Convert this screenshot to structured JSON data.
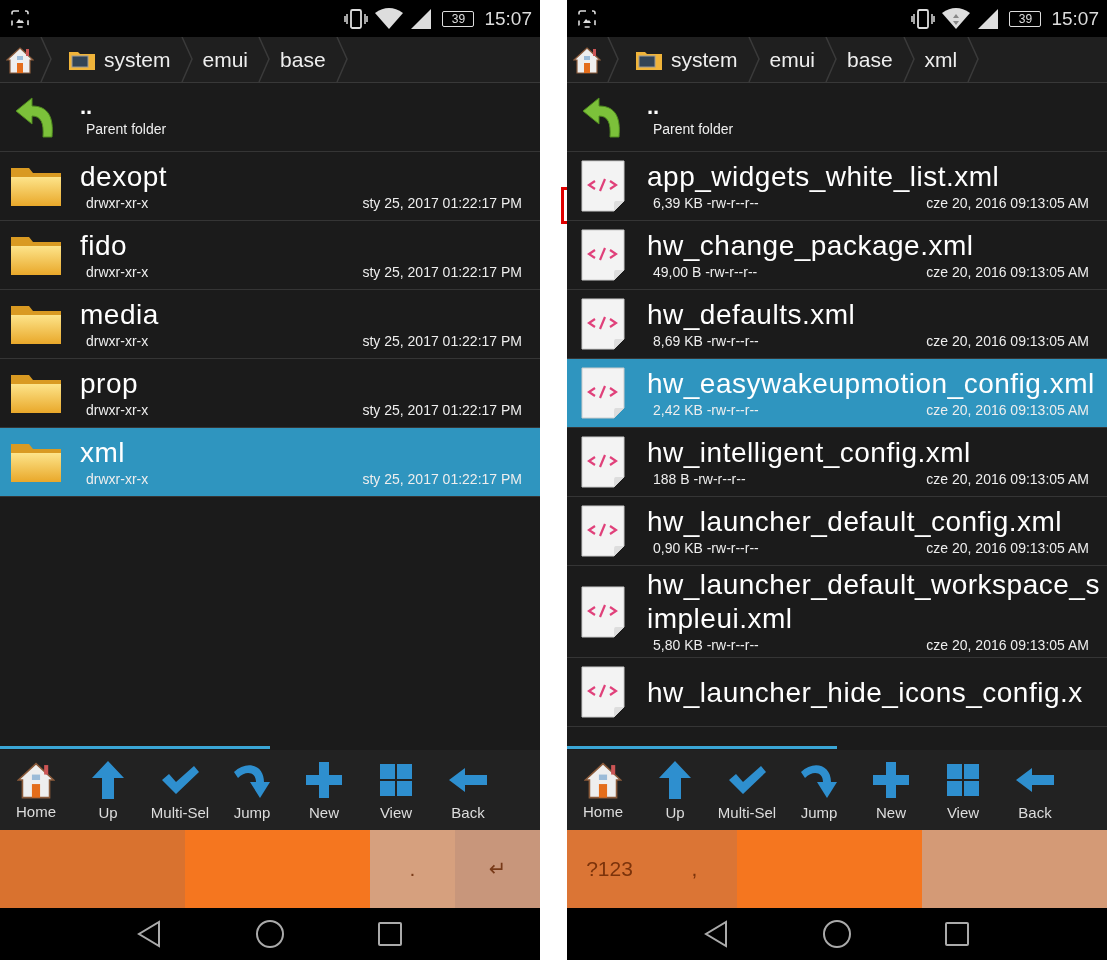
{
  "screens": [
    {
      "status_bar": {
        "wifi_arrows": false,
        "battery": "39",
        "time": "15:07"
      },
      "breadcrumbs": [
        "system",
        "emui",
        "base"
      ],
      "parent": {
        "name": "..",
        "label": "Parent folder"
      },
      "items": [
        {
          "kind": "folder",
          "name": "dexopt",
          "info": "drwxr-xr-x",
          "date": "sty 25, 2017 01:22:17 PM",
          "selected": false
        },
        {
          "kind": "folder",
          "name": "fido",
          "info": "drwxr-xr-x",
          "date": "sty 25, 2017 01:22:17 PM",
          "selected": false
        },
        {
          "kind": "folder",
          "name": "media",
          "info": "drwxr-xr-x",
          "date": "sty 25, 2017 01:22:17 PM",
          "selected": false
        },
        {
          "kind": "folder",
          "name": "prop",
          "info": "drwxr-xr-x",
          "date": "sty 25, 2017 01:22:17 PM",
          "selected": false
        },
        {
          "kind": "folder",
          "name": "xml",
          "info": "drwxr-xr-x",
          "date": "sty 25, 2017 01:22:17 PM",
          "selected": true
        }
      ],
      "toolbar": [
        {
          "kind": "home",
          "label": "Home"
        },
        {
          "kind": "up",
          "label": "Up"
        },
        {
          "kind": "multi",
          "label": "Multi-Sel"
        },
        {
          "kind": "jump",
          "label": "Jump"
        },
        {
          "kind": "new",
          "label": "New"
        },
        {
          "kind": "view",
          "label": "View"
        },
        {
          "kind": "back",
          "label": "Back"
        }
      ],
      "keyboard": [
        {
          "kind": "block",
          "color": "#d9722f"
        },
        {
          "kind": "block",
          "color": "#f5761f"
        },
        {
          "kind": "key",
          "color": "#d6a07e",
          "label": "."
        },
        {
          "kind": "key",
          "color": "#c8967b",
          "label": "↵"
        }
      ]
    },
    {
      "status_bar": {
        "wifi_arrows": true,
        "battery": "39",
        "time": "15:07"
      },
      "breadcrumbs": [
        "system",
        "emui",
        "base",
        "xml"
      ],
      "parent": {
        "name": "..",
        "label": "Parent folder"
      },
      "items": [
        {
          "kind": "xml",
          "name": "app_widgets_white_list.xml",
          "info": "6,39 KB -rw-r--r--",
          "date": "cze 20, 2016 09:13:05 AM",
          "selected": false
        },
        {
          "kind": "xml",
          "name": "hw_change_package.xml",
          "info": "49,00 B -rw-r--r--",
          "date": "cze 20, 2016 09:13:05 AM",
          "selected": false
        },
        {
          "kind": "xml",
          "name": "hw_defaults.xml",
          "info": "8,69 KB -rw-r--r--",
          "date": "cze 20, 2016 09:13:05 AM",
          "selected": false
        },
        {
          "kind": "xml",
          "name": "hw_easywakeupmotion_config.xml",
          "info": "2,42 KB -rw-r--r--",
          "date": "cze 20, 2016 09:13:05 AM",
          "selected": true
        },
        {
          "kind": "xml",
          "name": "hw_intelligent_config.xml",
          "info": "188 B -rw-r--r--",
          "date": "cze 20, 2016 09:13:05 AM",
          "selected": false
        },
        {
          "kind": "xml",
          "name": "hw_launcher_default_config.xml",
          "info": "0,90 KB -rw-r--r--",
          "date": "cze 20, 2016 09:13:05 AM",
          "selected": false
        },
        {
          "kind": "xml",
          "name": "hw_launcher_default_workspace_simpleui.xml",
          "info": "5,80 KB -rw-r--r--",
          "date": "cze 20, 2016 09:13:05 AM",
          "selected": false
        },
        {
          "kind": "xml",
          "name": "hw_launcher_hide_icons_config.x",
          "selected": false
        }
      ],
      "toolbar": [
        {
          "kind": "home",
          "label": "Home"
        },
        {
          "kind": "up",
          "label": "Up"
        },
        {
          "kind": "multi",
          "label": "Multi-Sel"
        },
        {
          "kind": "jump",
          "label": "Jump"
        },
        {
          "kind": "new",
          "label": "New"
        },
        {
          "kind": "view",
          "label": "View"
        },
        {
          "kind": "back",
          "label": "Back"
        }
      ],
      "keyboard": [
        {
          "kind": "key",
          "color": "#db7535",
          "label": "?123"
        },
        {
          "kind": "key",
          "color": "#db7535",
          "label": ","
        },
        {
          "kind": "block",
          "color": "#f5761f"
        },
        {
          "kind": "block",
          "color": "#d49a76"
        }
      ]
    }
  ]
}
